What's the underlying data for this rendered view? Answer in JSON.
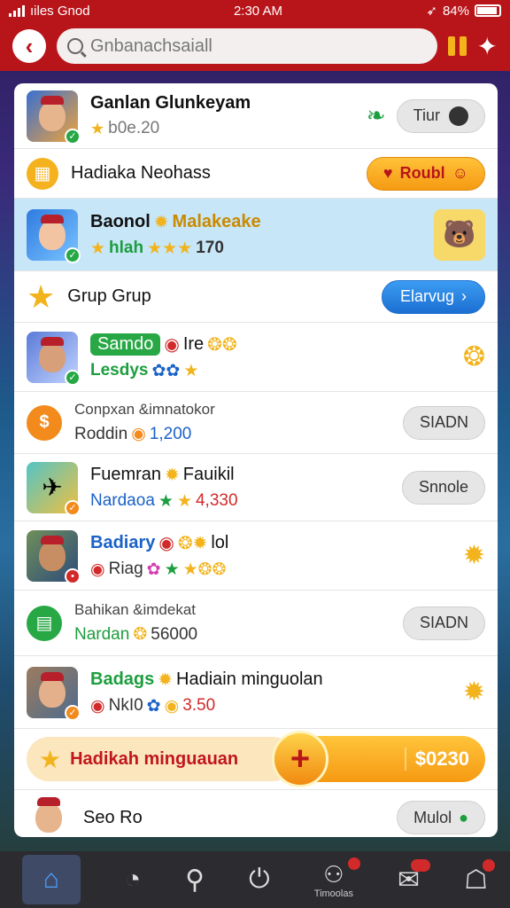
{
  "status": {
    "carrier": "ıiles Gnod",
    "time": "2:30 AM",
    "battery": "84%"
  },
  "search": {
    "placeholder": "Gnbanachsaiall"
  },
  "rows": {
    "r1": {
      "title": "Ganlan Glunkeyam",
      "value": "b0e.20",
      "button": "Tiur"
    },
    "r2": {
      "title": "Hadiaka Neohass",
      "button": "Roubl"
    },
    "r3": {
      "title_a": "Baonol",
      "title_b": "Malakeake",
      "sub_a": "hlah",
      "value": "170"
    },
    "r4": {
      "title": "Grup Grup",
      "button": "Elarvug"
    },
    "r5": {
      "title_a": "Samdo",
      "title_b": "Ire",
      "sub": "Lesdys"
    },
    "r6": {
      "title": "Conpxan &imnatokor",
      "sub": "Roddin",
      "value": "1,200",
      "button": "SIADN"
    },
    "r7": {
      "title": "Fuemran",
      "title_b": "Fauikil",
      "sub": "Nardaoa",
      "value": "4,330",
      "button": "Snnole"
    },
    "r8": {
      "title_a": "Badiary",
      "title_b": "lol",
      "sub": "Riag"
    },
    "r9": {
      "title": "Bahikan &imdekat",
      "sub": "Nardan",
      "value": "56000",
      "button": "SIADN"
    },
    "r10": {
      "title_a": "Badags",
      "title_b": "Hadiain minguolan",
      "sub": "NkI0",
      "value": "3.50"
    },
    "r11": {
      "label": "Hadikah minguauan",
      "value": "$0230"
    },
    "r12": {
      "title": "Seo Ro",
      "button": "Mulol"
    }
  },
  "tabbar": {
    "label": "Timoolas"
  },
  "colors": {
    "topbar": "#b8151a",
    "accent_yellow": "#f4b21b",
    "highlight_row": "#c7e6f8"
  }
}
